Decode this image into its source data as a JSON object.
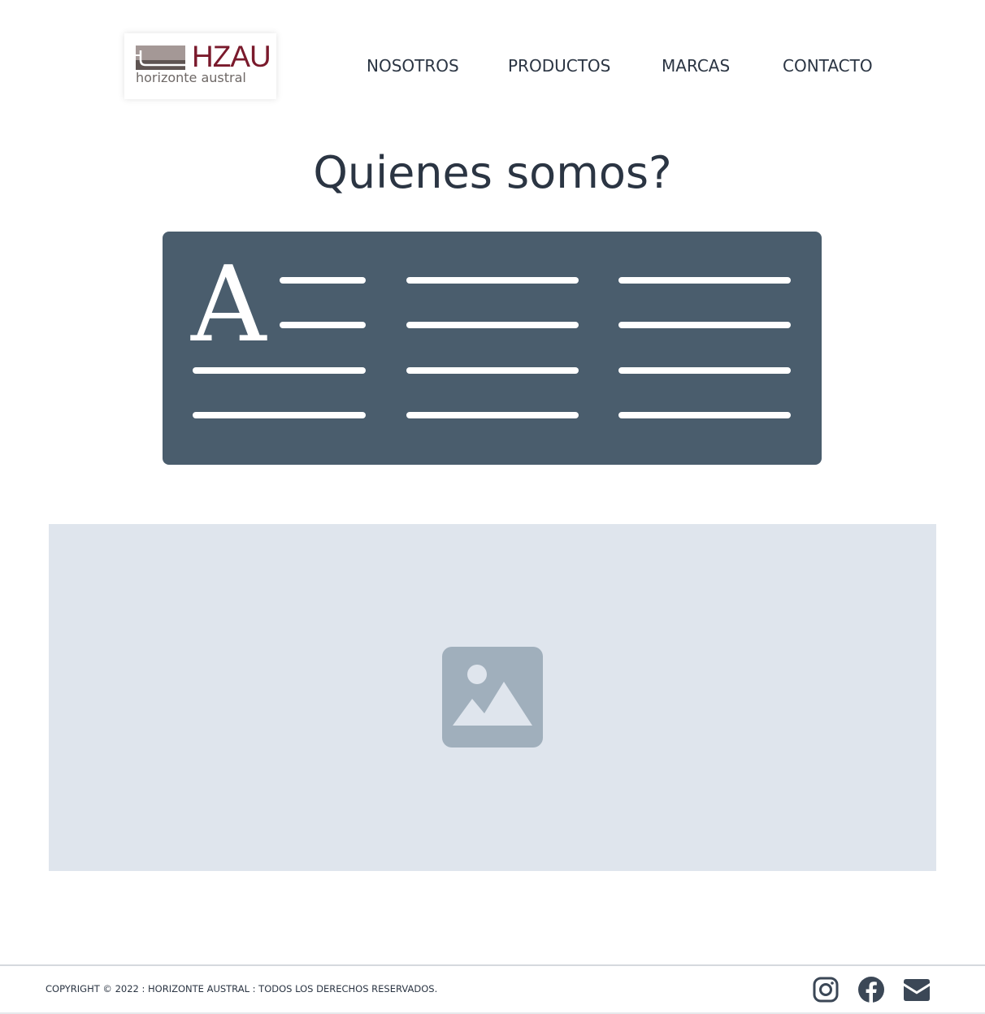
{
  "brand": {
    "logo_title": "HZAU",
    "logo_subtitle": "horizonte austral"
  },
  "nav": {
    "items": [
      {
        "label": "NOSOTROS"
      },
      {
        "label": "PRODUCTOS"
      },
      {
        "label": "MARCAS"
      },
      {
        "label": "CONTACTO"
      }
    ]
  },
  "main": {
    "title": "Quienes somos?"
  },
  "footer": {
    "copyright": "COPYRIGHT © 2022 : HORIZONTE AUSTRAL : TODOS LOS DERECHOS RESERVADOS.",
    "social": [
      "instagram-icon",
      "facebook-icon",
      "envelope-icon"
    ]
  },
  "colors": {
    "text": "#2b3543",
    "brand_red": "#7a1a2c",
    "illustration": "#4a5d6d",
    "image_bg": "#dfe5ed",
    "image_icon": "#a0afbc"
  }
}
